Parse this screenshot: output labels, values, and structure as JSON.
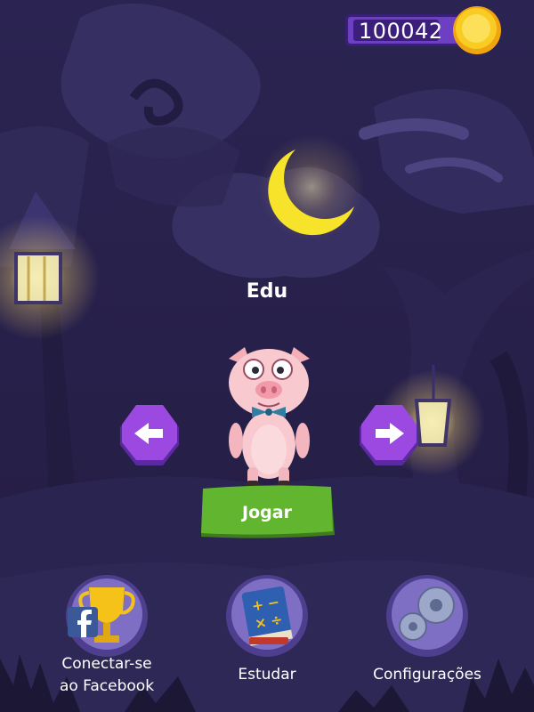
{
  "coins": {
    "value": "100042"
  },
  "character": {
    "name": "Edu"
  },
  "buttons": {
    "play_label": "Jogar"
  },
  "menu": [
    {
      "label_line1": "Conectar-se",
      "label_line2": "ao Facebook"
    },
    {
      "label": "Estudar"
    },
    {
      "label": "Configurações"
    }
  ],
  "colors": {
    "sky": "#2a2350",
    "moon": "#f7e32a",
    "coin": "#f6c21a",
    "nav_button": "#8a3fd6",
    "play_button": "#5fae2d",
    "facebook": "#3b5998"
  }
}
